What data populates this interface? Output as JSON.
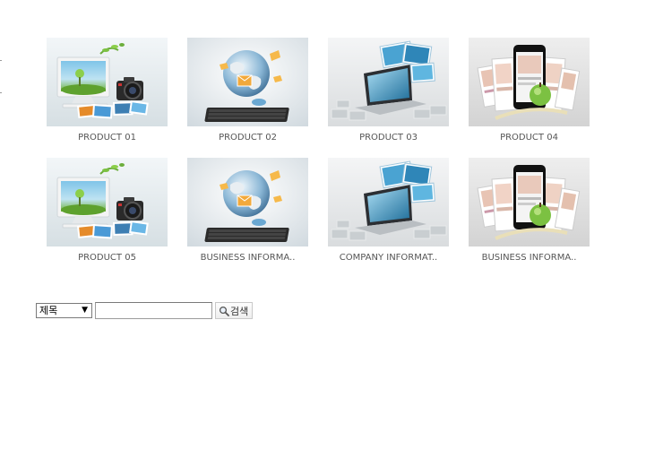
{
  "gallery": {
    "items": [
      {
        "caption": "PRODUCT 01",
        "image": "desktop-camera-photos"
      },
      {
        "caption": "PRODUCT 02",
        "image": "globe-keyboard"
      },
      {
        "caption": "PRODUCT 03",
        "image": "laptop-floating-screens"
      },
      {
        "caption": "PRODUCT 04",
        "image": "smartphone-app-screens"
      },
      {
        "caption": "PRODUCT 05",
        "image": "desktop-camera-photos"
      },
      {
        "caption": "BUSINESS INFORMA..",
        "image": "globe-keyboard"
      },
      {
        "caption": "COMPANY INFORMAT..",
        "image": "laptop-floating-screens"
      },
      {
        "caption": "BUSINESS INFORMA..",
        "image": "smartphone-app-screens"
      }
    ]
  },
  "search": {
    "select_value": "제목",
    "select_arrow": "▼",
    "input_value": "",
    "button_label": "검색",
    "button_icon": "search-icon"
  }
}
